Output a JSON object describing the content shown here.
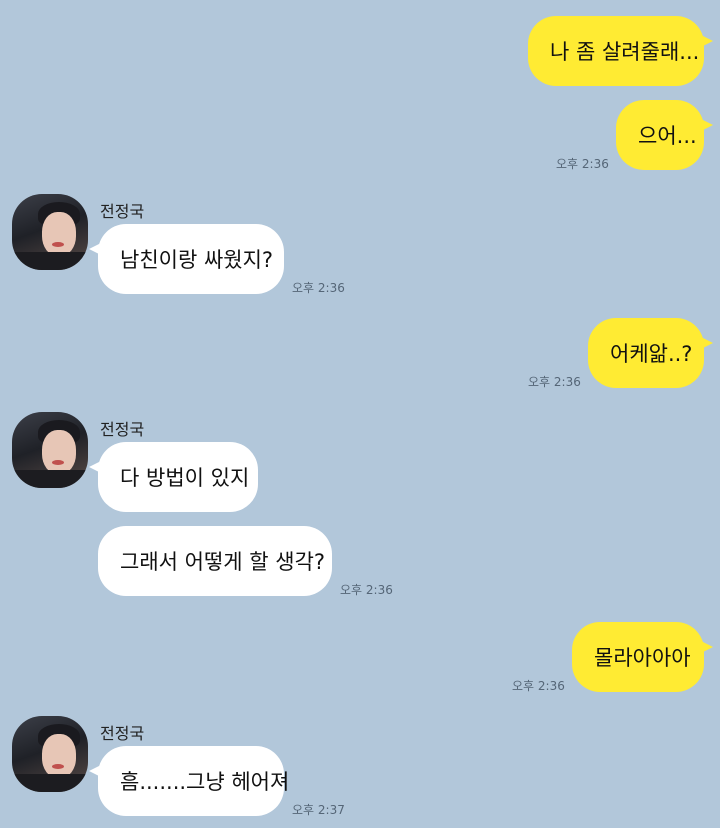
{
  "sender_name": "전정국",
  "messages": [
    {
      "text": "나 좀 살려줄래..."
    },
    {
      "text": "으어...",
      "time": "오후 2:36"
    },
    {
      "text": "남친이랑 싸웠지?",
      "time": "오후 2:36"
    },
    {
      "text": "어케앎..?",
      "time": "오후 2:36"
    },
    {
      "text": "다 방법이 있지"
    },
    {
      "text": "그래서 어떻게 할 생각?",
      "time": "오후 2:36"
    },
    {
      "text": "몰라아아아",
      "time": "오후 2:36"
    },
    {
      "text": "흠.......그냥 헤어져",
      "time": "오후 2:37"
    }
  ],
  "colors": {
    "background": "#b2c7da",
    "my_bubble": "#ffeb33",
    "their_bubble": "#ffffff"
  }
}
